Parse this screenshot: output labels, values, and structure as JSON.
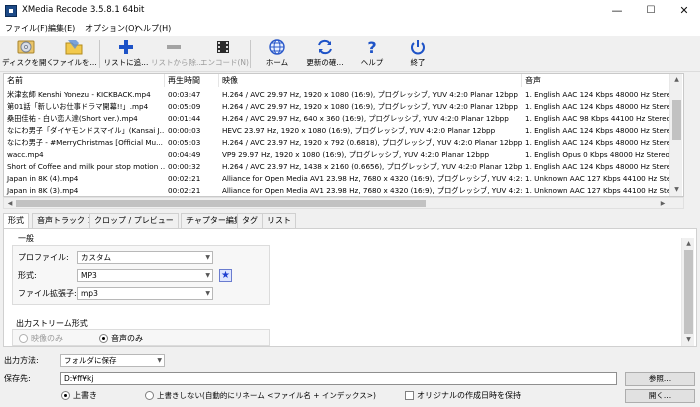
{
  "window": {
    "title": "XMedia Recode 3.5.8.1 64bit",
    "minimize": "—",
    "maximize": "☐",
    "close": "✕"
  },
  "menu": [
    "ファイル(F)",
    "編集(E)",
    "オプション(O)",
    "ヘルプ(H)"
  ],
  "toolbar": {
    "open_disc": "ディスクを開く",
    "open_file": "ファイルを...",
    "add_list": "リストに追...",
    "remove_list": "リストから除...",
    "encode": "エンコード(N)",
    "home": "ホーム",
    "update_check": "更新の確...",
    "help": "ヘルプ",
    "exit": "終了"
  },
  "file_table": {
    "headers": {
      "name": "名前",
      "duration": "再生時間",
      "video": "映像",
      "audio": "音声"
    },
    "rows": [
      {
        "name": "米津玄師 Kenshi Yonezu - KICKBACK.mp4",
        "duration": "00:03:47",
        "video": "H.264 / AVC  29.97 Hz, 1920 x 1080 (16:9), プログレッシブ, YUV 4:2:0 Planar 12bpp",
        "audio": "1. English AAC  124 Kbps 48000 Hz Stereo"
      },
      {
        "name": "第01話「新しいお仕事ドラマ開幕!!」.mp4",
        "duration": "00:05:09",
        "video": "H.264 / AVC  29.97 Hz, 1920 x 1080 (16:9), プログレッシブ, YUV 4:2:0 Planar 12bpp",
        "audio": "1. English AAC  124 Kbps 48000 Hz Stereo"
      },
      {
        "name": "桑田佳祐 - 白い恋人達(Short ver.).mp4",
        "duration": "00:01:44",
        "video": "H.264 / AVC  29.97 Hz, 640 x 360 (16:9), プログレッシブ, YUV 4:2:0 Planar 12bpp",
        "audio": "1. English AAC  98 Kbps 44100 Hz Stereo"
      },
      {
        "name": "なにわ男子「ダイヤモンドスマイル」(Kansai J...",
        "duration": "00:00:03",
        "video": "HEVC 23.97 Hz, 1920 x 1080 (16:9), プログレッシブ, YUV 4:2:0 Planar 12bpp",
        "audio": "1. English AAC  124 Kbps 48000 Hz Stereo"
      },
      {
        "name": "なにわ男子 - #MerryChristmas [Official Mu...",
        "duration": "00:05:03",
        "video": "H.264 / AVC  23.97 Hz, 1920 x 792 (0.6818), プログレッシブ, YUV 4:2:0 Planar 12bpp",
        "audio": "1. English AAC  124 Kbps 48000 Hz Stereo"
      },
      {
        "name": "wacc.mp4",
        "duration": "00:04:49",
        "video": "VP9 29.97 Hz, 1920 x 1080 (16:9), プログレッシブ, YUV 4:2:0 Planar 12bpp",
        "audio": "1. English Opus 0 Kbps 48000 Hz Stereo"
      },
      {
        "name": "Short of Coffee and milk pour stop motion ...",
        "duration": "00:00:32",
        "video": "H.264 / AVC  23.97 Hz, 1438 x 2160 (0.6656), プログレッシブ, YUV 4:2:0 Planar 12bpp",
        "audio": "1. English AAC  124 Kbps 48000 Hz Stereo"
      },
      {
        "name": "Japan in 8K  (4).mp4",
        "duration": "00:02:21",
        "video": "Alliance for Open Media AV1 23.98 Hz, 7680 x 4320 (16:9), プログレッシブ, YUV 4:2:0 Planar 12bpp",
        "audio": "1. Unknown AAC  127 Kbps 44100 Hz Stereo"
      },
      {
        "name": "Japan in 8K  (3).mp4",
        "duration": "00:02:21",
        "video": "Alliance for Open Media AV1 23.98 Hz, 7680 x 4320 (16:9), プログレッシブ, YUV 4:2:0 Planar 12bpp",
        "audio": "1. Unknown AAC  127 Kbps 44100 Hz Stereo"
      }
    ]
  },
  "tabs": [
    "形式",
    "音声トラック 1",
    "クロップ / プレビュー",
    "チャプター編集",
    "タグ",
    "リスト"
  ],
  "format_panel": {
    "general_title": "一般",
    "profile_label": "プロファイル:",
    "profile_value": "カスタム",
    "format_label": "形式:",
    "format_value": "MP3",
    "ext_label": "ファイル拡張子:",
    "ext_value": "mp3",
    "stream_title": "出力ストリーム形式",
    "video_only": "映像のみ",
    "audio_only": "音声のみ"
  },
  "output": {
    "method_label": "出力方法:",
    "method_value": "フォルダに保存",
    "dest_label": "保存先:",
    "dest_value": "D:¥ff¥kj",
    "browse": "参照...",
    "open": "開く...",
    "overwrite": "上書き",
    "no_overwrite": "上書きしない(自動的にリネーム <ファイル名 + インデックス>)",
    "keep_date": "オリジナルの作成日時を保持"
  }
}
